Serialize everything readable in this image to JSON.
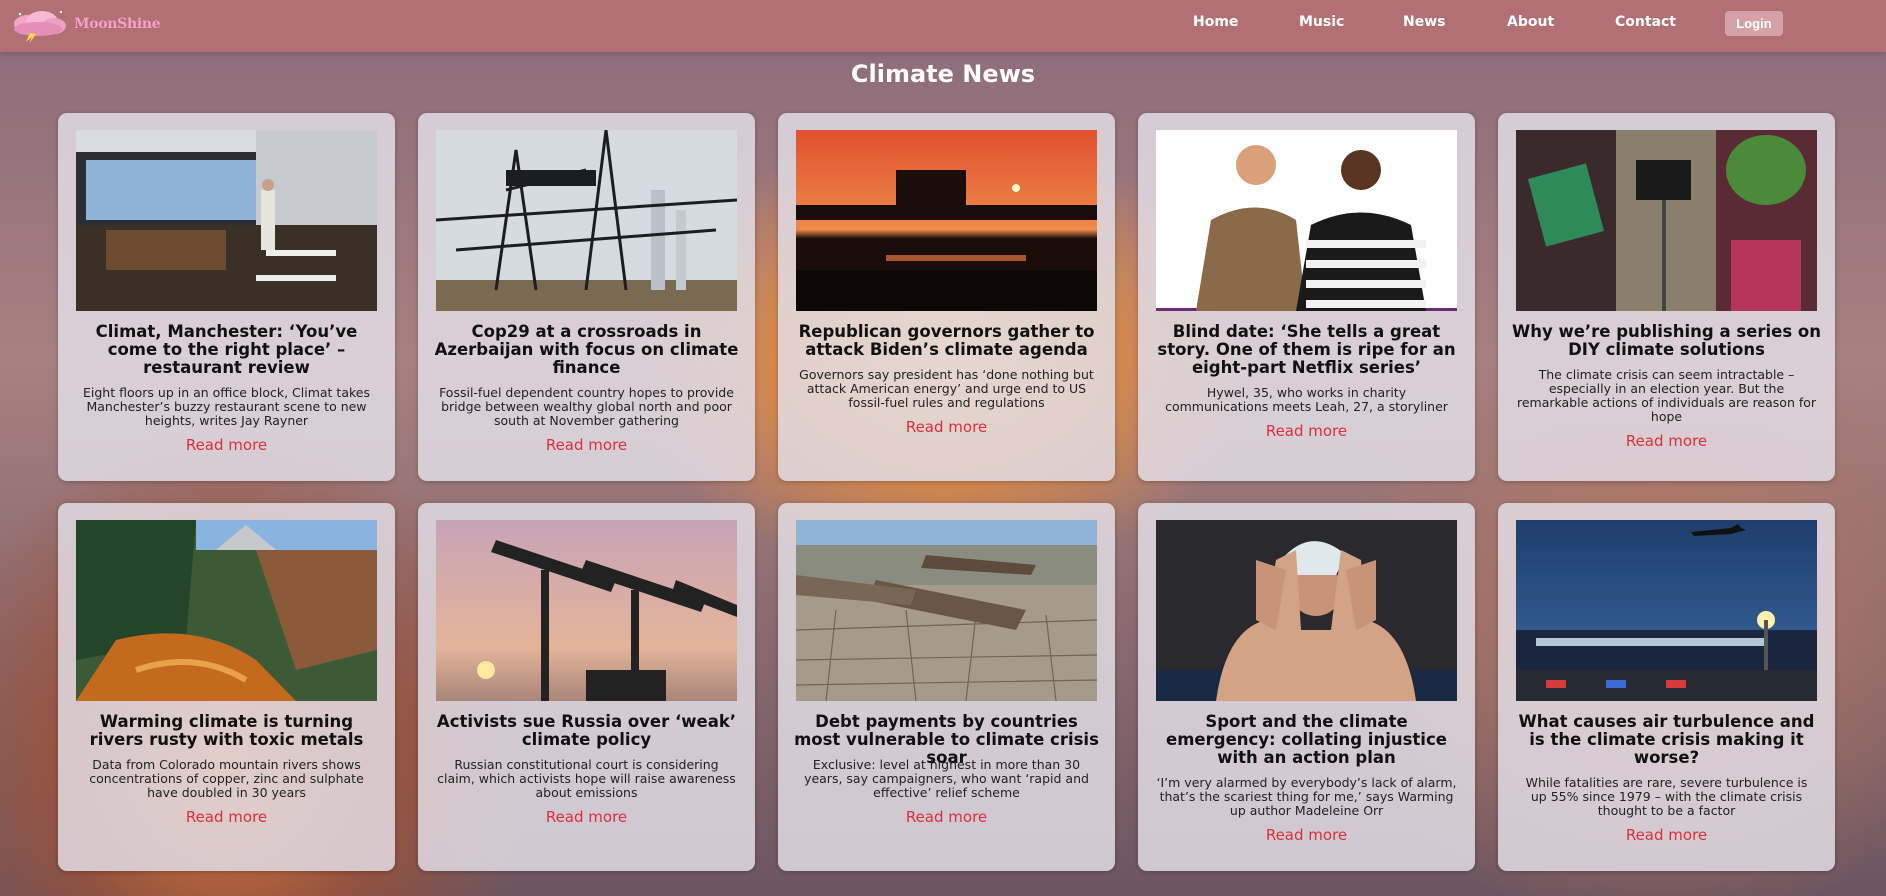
{
  "brand": {
    "name": "MoonShine"
  },
  "nav": {
    "items": [
      {
        "label": "Home"
      },
      {
        "label": "Music"
      },
      {
        "label": "News"
      },
      {
        "label": "About"
      },
      {
        "label": "Contact"
      }
    ],
    "login_label": "Login"
  },
  "page": {
    "title": "Climate News"
  },
  "read_more_label": "Read more",
  "articles": [
    {
      "headline": "Climat, Manchester: ‘You’ve come to the right place’ – restaurant review",
      "summary": "Eight floors up in an office block, Climat takes Manchester’s buzzy restaurant scene to new heights, writes Jay Rayner",
      "image": "restaurant-interior"
    },
    {
      "headline": "Cop29 at a crossroads in Azerbaijan with focus on climate finance",
      "summary": "Fossil-fuel dependent country hopes to provide bridge between wealthy global north and poor south at November gathering",
      "image": "oil-derricks"
    },
    {
      "headline": "Republican governors gather to attack Biden’s climate agenda",
      "summary": "Governors say president has ‘done nothing but attack American energy’ and urge end to US fossil-fuel rules and regulations",
      "image": "refinery-sunset"
    },
    {
      "headline": "Blind date: ‘She tells a great story. One of them is ripe for an eight-part Netflix series’",
      "summary": "Hywel, 35, who works in charity communications meets Leah, 27, a storyliner",
      "image": "two-people-portrait"
    },
    {
      "headline": "Why we’re publishing a series on DIY climate solutions",
      "summary": "The climate crisis can seem intractable – especially in an election year. But the remarkable actions of individuals are reason for hope",
      "image": "diy-collage"
    },
    {
      "headline": "Warming climate is turning rivers rusty with toxic metals",
      "summary": "Data from Colorado mountain rivers shows concentrations of copper, zinc and sulphate have doubled in 30 years",
      "image": "rusty-river"
    },
    {
      "headline": "Activists sue Russia over ‘weak’ climate policy",
      "summary": "Russian constitutional court is considering claim, which activists hope will raise awareness about emissions",
      "image": "oil-pumpjacks"
    },
    {
      "headline": "Debt payments by countries most vulnerable to climate crisis soar",
      "summary": "Exclusive: level at highest in more than 30 years, say campaigners, who want ‘rapid and effective’ relief scheme",
      "image": "boats-dry-lakebed"
    },
    {
      "headline": "Sport and the climate emergency: collating injustice with an action plan",
      "summary": "‘I’m very alarmed by everybody’s lack of alarm, that’s the scariest thing for me,’ says Warming up author Madeleine Orr",
      "image": "tennis-player-ice"
    },
    {
      "headline": "What causes air turbulence and is the climate crisis making it worse?",
      "summary": "While fatalities are rare, severe turbulence is up 55% since 1979 – with the climate crisis thought to be a factor",
      "image": "airport-night"
    }
  ]
}
